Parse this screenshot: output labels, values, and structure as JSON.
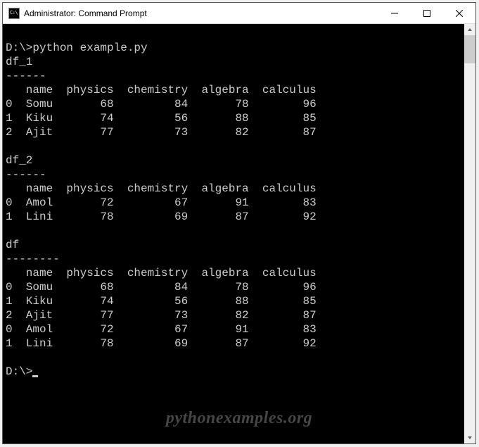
{
  "window": {
    "title": "Administrator: Command Prompt"
  },
  "prompt": "D:\\>",
  "command": "python example.py",
  "sections": [
    {
      "label": "df_1",
      "sep": "------",
      "columns": [
        "",
        "name",
        "physics",
        "chemistry",
        "algebra",
        "calculus"
      ],
      "rows": [
        {
          "idx": "0",
          "name": "Somu",
          "physics": 68,
          "chemistry": 84,
          "algebra": 78,
          "calculus": 96
        },
        {
          "idx": "1",
          "name": "Kiku",
          "physics": 74,
          "chemistry": 56,
          "algebra": 88,
          "calculus": 85
        },
        {
          "idx": "2",
          "name": "Ajit",
          "physics": 77,
          "chemistry": 73,
          "algebra": 82,
          "calculus": 87
        }
      ]
    },
    {
      "label": "df_2",
      "sep": "------",
      "columns": [
        "",
        "name",
        "physics",
        "chemistry",
        "algebra",
        "calculus"
      ],
      "rows": [
        {
          "idx": "0",
          "name": "Amol",
          "physics": 72,
          "chemistry": 67,
          "algebra": 91,
          "calculus": 83
        },
        {
          "idx": "1",
          "name": "Lini",
          "physics": 78,
          "chemistry": 69,
          "algebra": 87,
          "calculus": 92
        }
      ]
    },
    {
      "label": "df",
      "sep": "--------",
      "columns": [
        "",
        "name",
        "physics",
        "chemistry",
        "algebra",
        "calculus"
      ],
      "rows": [
        {
          "idx": "0",
          "name": "Somu",
          "physics": 68,
          "chemistry": 84,
          "algebra": 78,
          "calculus": 96
        },
        {
          "idx": "1",
          "name": "Kiku",
          "physics": 74,
          "chemistry": 56,
          "algebra": 88,
          "calculus": 85
        },
        {
          "idx": "2",
          "name": "Ajit",
          "physics": 77,
          "chemistry": 73,
          "algebra": 82,
          "calculus": 87
        },
        {
          "idx": "0",
          "name": "Amol",
          "physics": 72,
          "chemistry": 67,
          "algebra": 91,
          "calculus": 83
        },
        {
          "idx": "1",
          "name": "Lini",
          "physics": 78,
          "chemistry": 69,
          "algebra": 87,
          "calculus": 92
        }
      ]
    }
  ],
  "watermark": "pythonexamples.org"
}
